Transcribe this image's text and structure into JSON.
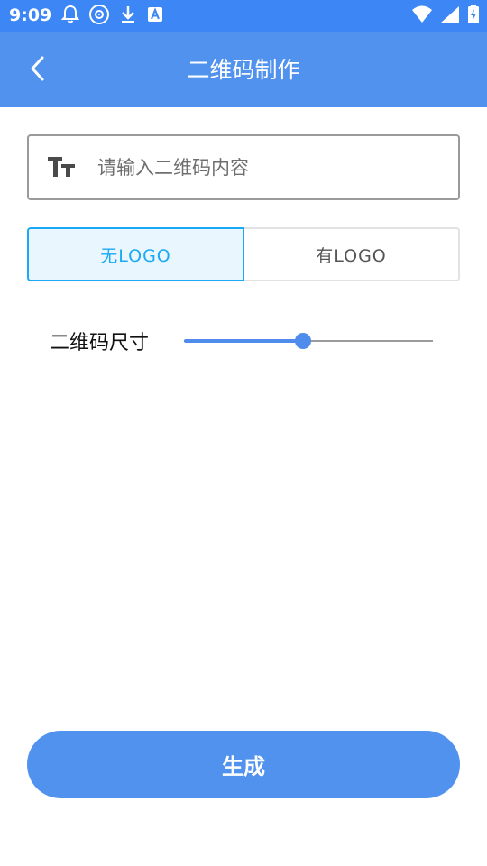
{
  "status_bar": {
    "time": "9:09",
    "left_icons": [
      "notification-bell-icon",
      "disc-icon",
      "download-icon",
      "font-a-icon"
    ],
    "right_icons": [
      "wifi-icon",
      "signal-icon",
      "battery-charging-icon"
    ]
  },
  "app_bar": {
    "title": "二维码制作",
    "back_icon": "chevron-left-icon",
    "color": "#5092ee"
  },
  "content_input": {
    "icon": "text-size-icon",
    "placeholder": "请输入二维码内容",
    "value": ""
  },
  "logo_toggle": {
    "options": [
      {
        "label": "无LOGO",
        "selected": true
      },
      {
        "label": "有LOGO",
        "selected": false
      }
    ],
    "active_color": "#1aa9f5"
  },
  "qr_size": {
    "label": "二维码尺寸",
    "value_fraction": 0.48
  },
  "generate_button": {
    "label": "生成",
    "color": "#5092ee"
  }
}
